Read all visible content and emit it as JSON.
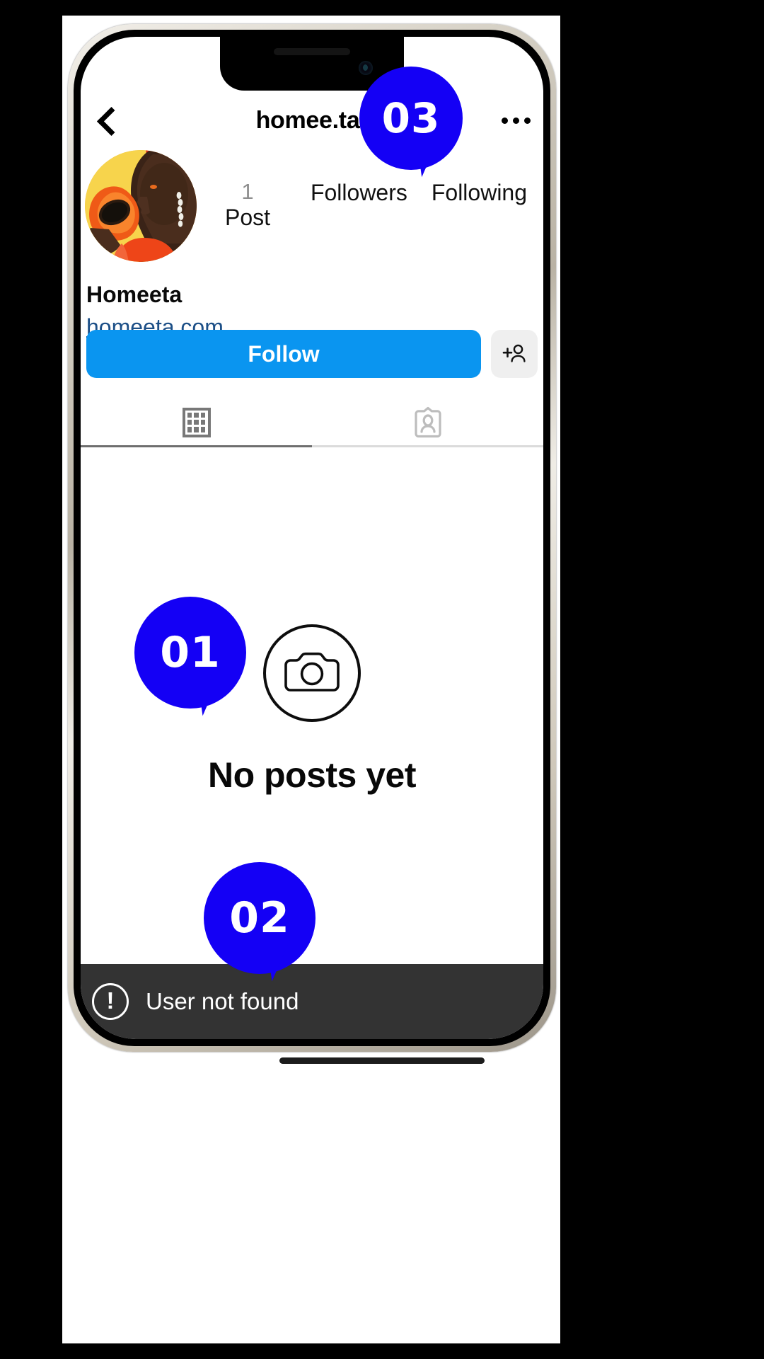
{
  "app": {
    "header": {
      "back_icon": "chevron-left-icon",
      "title": "homee.ta",
      "menu_icon": "more-options-icon"
    },
    "profile": {
      "avatar_alt": "profile-photo",
      "display_name": "Homeeta",
      "bio_link": "homeeta.com",
      "stats": [
        {
          "count": "1",
          "label": "Post"
        },
        {
          "count": "",
          "label": "Followers"
        },
        {
          "count": "",
          "label": "Following"
        }
      ]
    },
    "actions": {
      "follow_label": "Follow",
      "add_user_icon": "add-person-icon"
    },
    "tabs": [
      {
        "id": "grid",
        "icon": "grid-icon",
        "active": true
      },
      {
        "id": "tagged",
        "icon": "tagged-person-icon",
        "active": false
      }
    ],
    "empty_state": {
      "icon": "camera-circle-icon",
      "title": "No posts yet"
    },
    "toast": {
      "icon": "exclamation-circle-icon",
      "icon_glyph": "!",
      "message": "User not found"
    }
  },
  "annotations": [
    {
      "id": "01",
      "label": "01"
    },
    {
      "id": "02",
      "label": "02"
    },
    {
      "id": "03",
      "label": "03"
    }
  ],
  "colors": {
    "follow_blue": "#0A95F0",
    "annotation_blue": "#1400F5",
    "link_blue": "#1C4F87",
    "toast_bg": "#333333",
    "muted_gray": "#8E8E8E"
  }
}
